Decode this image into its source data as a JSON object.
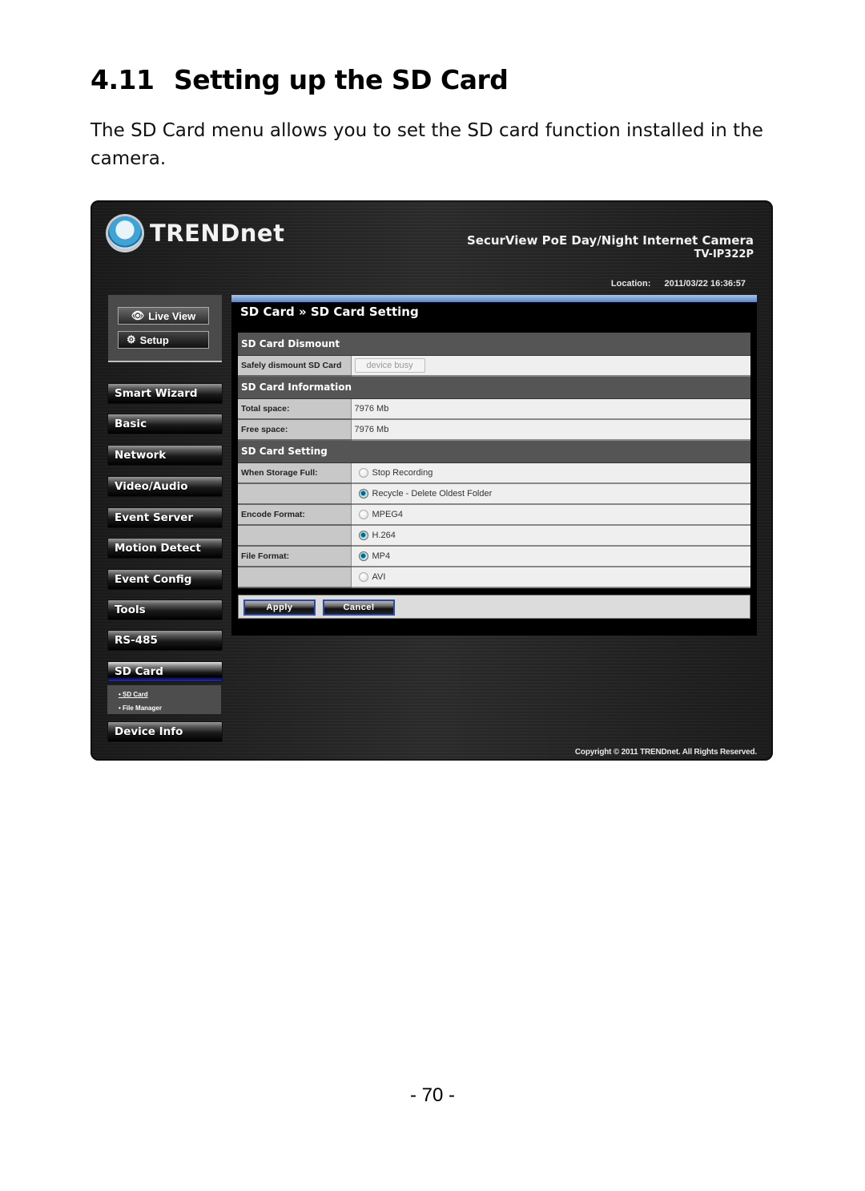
{
  "document": {
    "section_number": "4.11",
    "heading": "Setting up the SD Card",
    "paragraph": "The SD Card menu allows you to set the SD card function installed in the camera.",
    "page_number": "- 70 -"
  },
  "camera_ui": {
    "logo_text": "TRENDnet",
    "product_title": "SecurView PoE Day/Night Internet Camera",
    "product_model": "TV-IP322P",
    "location_label": "Location:",
    "location_datetime": "2011/03/22 16:36:57",
    "top_nav": [
      {
        "label": "Live View",
        "icon": "eye-icon"
      },
      {
        "label": "Setup",
        "icon": "gears-icon"
      }
    ],
    "menu": [
      {
        "label": "Smart Wizard",
        "active": false
      },
      {
        "label": "Basic",
        "active": false
      },
      {
        "label": "Network",
        "active": false
      },
      {
        "label": "Video/Audio",
        "active": false
      },
      {
        "label": "Event Server",
        "active": false
      },
      {
        "label": "Motion Detect",
        "active": false
      },
      {
        "label": "Event Config",
        "active": false
      },
      {
        "label": "Tools",
        "active": false
      },
      {
        "label": "RS-485",
        "active": false
      },
      {
        "label": "SD Card",
        "active": true
      },
      {
        "label": "Device Info",
        "active": false
      }
    ],
    "sub_menu": [
      {
        "label": "SD Card",
        "selected": true
      },
      {
        "label": "File Manager",
        "selected": false
      }
    ],
    "breadcrumb": "SD Card » SD Card Setting",
    "sections": {
      "dismount": {
        "title": "SD Card Dismount",
        "label": "Safely dismount SD Card",
        "button": "device busy"
      },
      "information": {
        "title": "SD Card Information",
        "total_label": "Total space:",
        "total_value": "7976 Mb",
        "free_label": "Free space:",
        "free_value": "7976 Mb"
      },
      "setting": {
        "title": "SD Card Setting",
        "storage_full_label": "When Storage Full:",
        "storage_full_options": [
          {
            "label": "Stop Recording",
            "selected": false
          },
          {
            "label": "Recycle - Delete Oldest Folder",
            "selected": true
          }
        ],
        "encode_label": "Encode Format:",
        "encode_options": [
          {
            "label": "MPEG4",
            "selected": false
          },
          {
            "label": "H.264",
            "selected": true
          }
        ],
        "file_label": "File Format:",
        "file_options": [
          {
            "label": "MP4",
            "selected": true
          },
          {
            "label": "AVI",
            "selected": false
          }
        ]
      }
    },
    "buttons": {
      "apply": "Apply",
      "cancel": "Cancel"
    },
    "copyright": "Copyright © 2011 TRENDnet. All Rights Reserved.",
    "colors": {
      "accent_blue": "#2a4aa8",
      "section_header": "#555555",
      "active_menu_underline": "#1a2bd0"
    }
  }
}
